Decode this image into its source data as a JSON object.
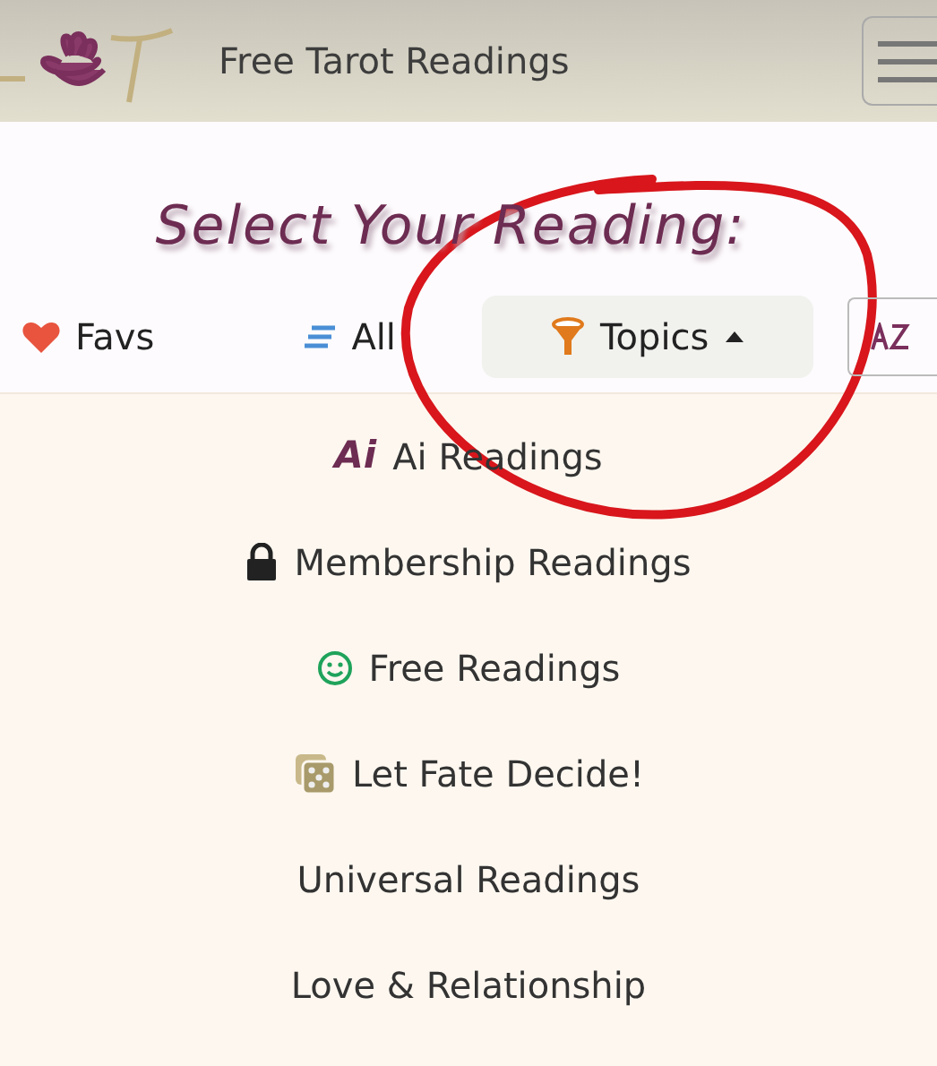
{
  "header": {
    "site_title": "Free Tarot Readings"
  },
  "heading": "Select Your Reading:",
  "tabs": [
    {
      "label": "Favs",
      "kind": "heart",
      "selected": false
    },
    {
      "label": "All",
      "kind": "lines",
      "selected": false
    },
    {
      "label": "Topics",
      "kind": "funnel",
      "selected": true,
      "expanded": true
    },
    {
      "kind": "sort",
      "selected": false
    }
  ],
  "menu": [
    {
      "label": "Ai Readings",
      "kind": "ai",
      "icon_text": "Ai"
    },
    {
      "label": "Membership Readings",
      "kind": "lock"
    },
    {
      "label": "Free Readings",
      "kind": "smile"
    },
    {
      "label": "Let Fate Decide!",
      "kind": "dice"
    },
    {
      "label": "Universal Readings",
      "kind": "plain"
    },
    {
      "label": "Love & Relationship",
      "kind": "plain"
    }
  ]
}
